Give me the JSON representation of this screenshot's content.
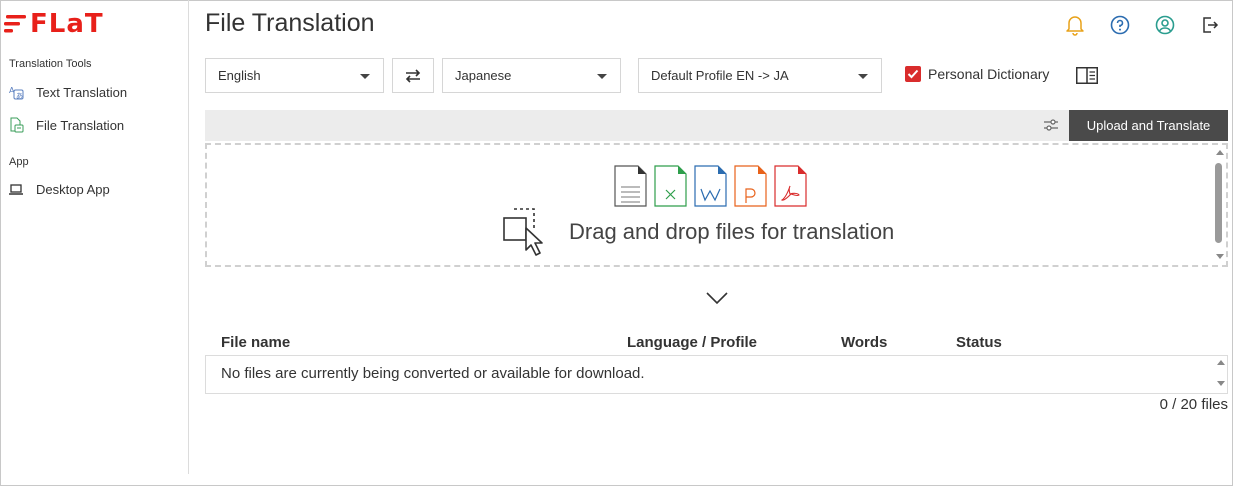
{
  "app": {
    "logo_text": "FLaT",
    "brand_color": "#e8201a"
  },
  "sidebar": {
    "sections": [
      {
        "title": "Translation Tools",
        "items": [
          {
            "label": "Text Translation",
            "icon": "translate-icon"
          },
          {
            "label": "File Translation",
            "icon": "file-translate-icon"
          }
        ]
      },
      {
        "title": "App",
        "items": [
          {
            "label": "Desktop App",
            "icon": "laptop-icon"
          }
        ]
      }
    ]
  },
  "header": {
    "title": "File Translation",
    "icons": [
      "bell-icon",
      "help-icon",
      "user-icon",
      "logout-icon"
    ]
  },
  "controls": {
    "source_language": "English",
    "target_language": "Japanese",
    "profile": "Default Profile EN -> JA",
    "personal_dictionary_label": "Personal Dictionary",
    "personal_dictionary_checked": true,
    "checkbox_color": "#d92c2c"
  },
  "upload": {
    "button_label": "Upload and Translate"
  },
  "dropzone": {
    "text": "Drag and drop files for translation",
    "file_types": [
      {
        "name": "txt-file-icon",
        "letter": "",
        "color": "#555555"
      },
      {
        "name": "excel-file-icon",
        "letter": "x",
        "color": "#2e9e4b"
      },
      {
        "name": "word-file-icon",
        "letter": "w",
        "color": "#2b6cb0"
      },
      {
        "name": "powerpoint-file-icon",
        "letter": "p",
        "color": "#e8621a"
      },
      {
        "name": "pdf-file-icon",
        "letter": "",
        "color": "#d92c2c"
      }
    ]
  },
  "table": {
    "columns": [
      "File name",
      "Language / Profile",
      "Words",
      "Status"
    ],
    "empty_message": "No files are currently being converted or available for download.",
    "file_count": "0 / 20 files"
  }
}
